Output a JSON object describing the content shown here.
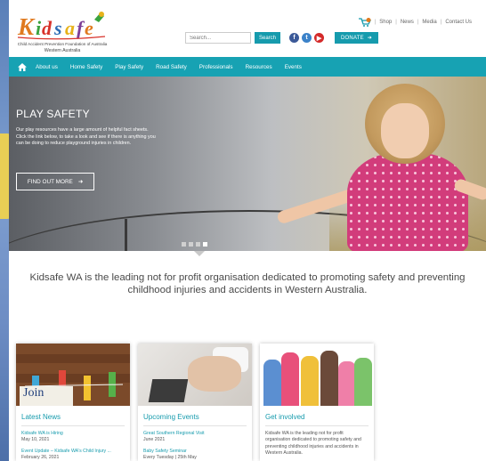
{
  "header": {
    "logo_lines": [
      "Child Accident Prevention Foundation of Australia",
      "Western Australia"
    ],
    "top_links": [
      "Shop",
      "News",
      "Media",
      "Contact Us"
    ],
    "search_placeholder": "Search...",
    "search_button": "Search",
    "social": [
      "f",
      "t",
      "▶"
    ],
    "donate_label": "DONATE"
  },
  "nav": {
    "items": [
      "About us",
      "Home Safety",
      "Play Safety",
      "Road Safety",
      "Professionals",
      "Resources",
      "Events"
    ]
  },
  "hero": {
    "title": "PLAY SAFETY",
    "text": "Our play resources have a large amount of helpful fact sheets. Click the link below, to take a look and see if there is anything you can be doing to reduce playground injuries in children.",
    "button": "FIND OUT MORE",
    "slides_total": 4,
    "slide_active": 4
  },
  "intro": "Kidsafe WA is the leading not for profit organisation dedicated to promoting safety and preventing childhood injuries and accidents in Western Australia.",
  "cards": [
    {
      "title": "Latest News",
      "image_text": "Join",
      "items": [
        {
          "link": "Kidsafe WA is Hiring",
          "date": "May 10, 2021"
        },
        {
          "link": "Event Update – Kidsafe WA's Child Injury ...",
          "date": "February 26, 2021"
        }
      ]
    },
    {
      "title": "Upcoming Events",
      "items": [
        {
          "link": "Great Southern Regional Visit",
          "date": "June 2021"
        },
        {
          "link": "Baby Safety Seminar",
          "date": "Every Tuesday | 25th May"
        }
      ]
    },
    {
      "title": "Get involved",
      "text": "Kidsafe WA is the leading not for profit organisation dedicated to promoting safety and preventing childhood injuries and accidents in Western Australia."
    }
  ],
  "colors": {
    "accent": "#169bad",
    "nav_bg": "#17a2b3"
  }
}
